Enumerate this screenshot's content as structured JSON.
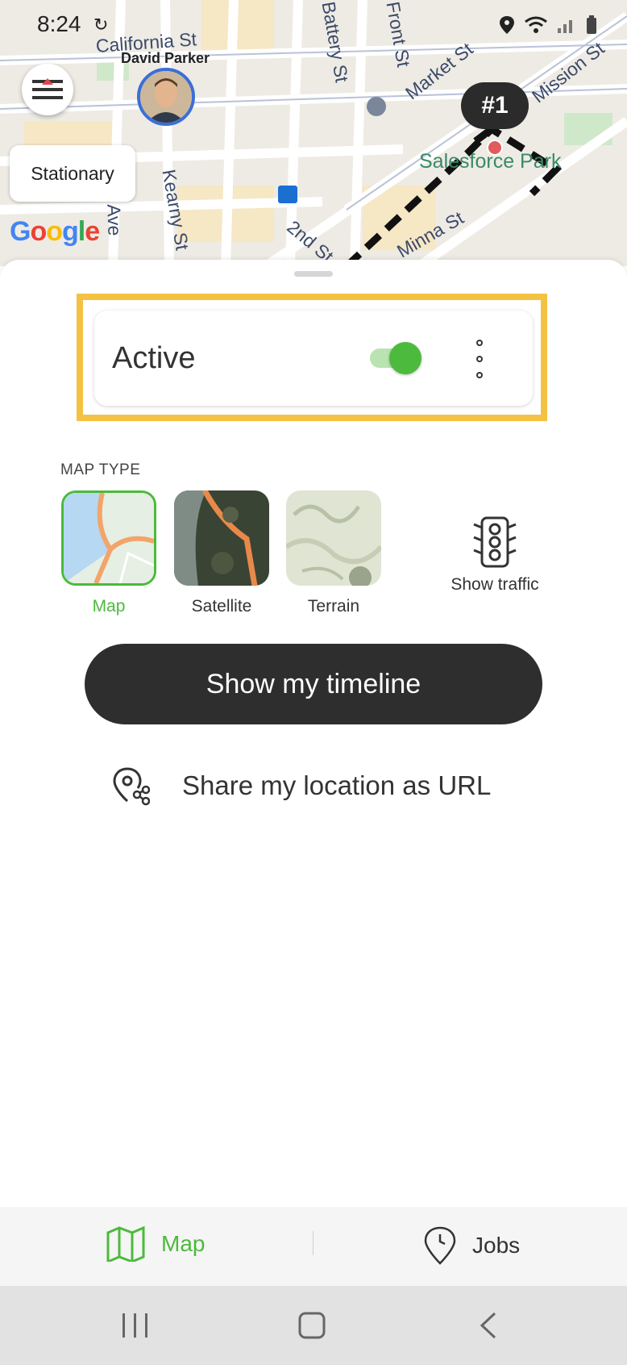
{
  "status_bar": {
    "time": "8:24"
  },
  "map": {
    "street_labels": [
      "California St",
      "Battery St",
      "Front St",
      "Market St",
      "Mission St",
      "Kearny St",
      "Grant Ave",
      "2nd St",
      "Minna St"
    ],
    "user_marker_name": "David Parker",
    "stationary_label": "Stationary",
    "google_label": "Google",
    "job_marker_label": "#1",
    "park_label": "Salesforce Park"
  },
  "sheet": {
    "active_label": "Active",
    "active_toggle_on": true,
    "map_type_heading": "MAP TYPE",
    "map_types": [
      {
        "label": "Map",
        "selected": true
      },
      {
        "label": "Satellite",
        "selected": false
      },
      {
        "label": "Terrain",
        "selected": false
      }
    ],
    "traffic_label": "Show traffic",
    "timeline_button": "Show my timeline",
    "share_label": "Share my location as URL"
  },
  "bottom_nav": {
    "items": [
      {
        "label": "Map",
        "icon": "map-icon",
        "active": true
      },
      {
        "label": "Jobs",
        "icon": "location-clock-icon",
        "active": false
      }
    ]
  },
  "colors": {
    "accent_green": "#4cba3c",
    "highlight_yellow": "#f4c242",
    "dark_button": "#2e2e2e",
    "avatar_ring": "#3b6fd8"
  }
}
